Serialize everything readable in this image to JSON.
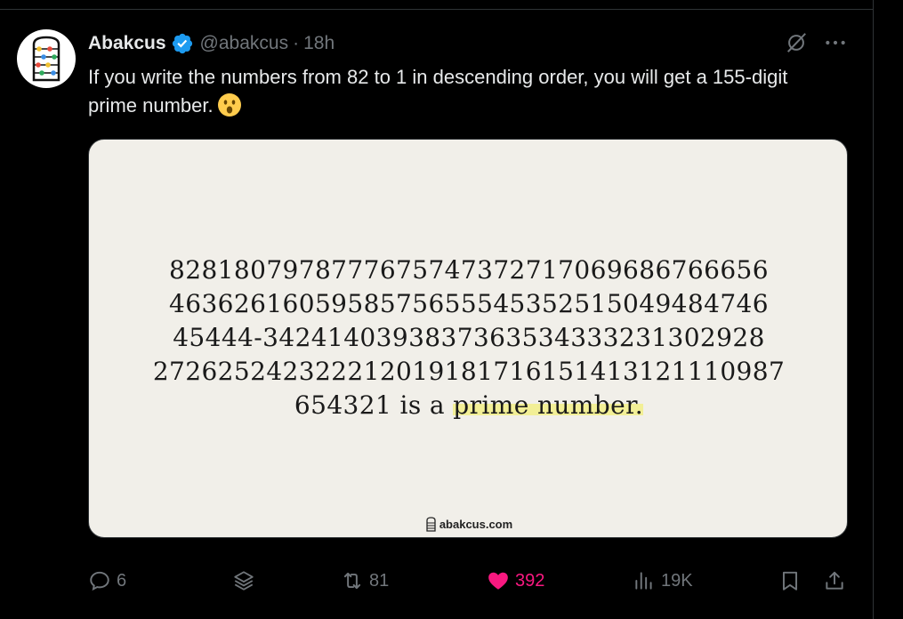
{
  "tweet": {
    "author_name": "Abakcus",
    "handle": "@abakcus",
    "separator": "·",
    "time": "18h",
    "text": "If you write the numbers from 82 to 1 in descending order, you will get a 155-digit prime number.",
    "emoji": "face-with-open-mouth"
  },
  "media": {
    "lines": [
      "828180797877767574737271706968676665​6",
      "46362616059585756555453525150494847​46",
      "45444-342414039383736353433323130292​8",
      "27262524232221201918171615141312111098​7"
    ],
    "last_line_prefix": "654321 is a ",
    "last_line_highlight": "prime number.",
    "site": "abakcus.com",
    "background": "#f1efe9",
    "highlight_color": "#f2ef96"
  },
  "actions": {
    "replies": "6",
    "reposts": "81",
    "likes": "392",
    "views": "19K"
  },
  "colors": {
    "muted": "#71767b",
    "like": "#f91880",
    "verified": "#1d9bf0"
  }
}
